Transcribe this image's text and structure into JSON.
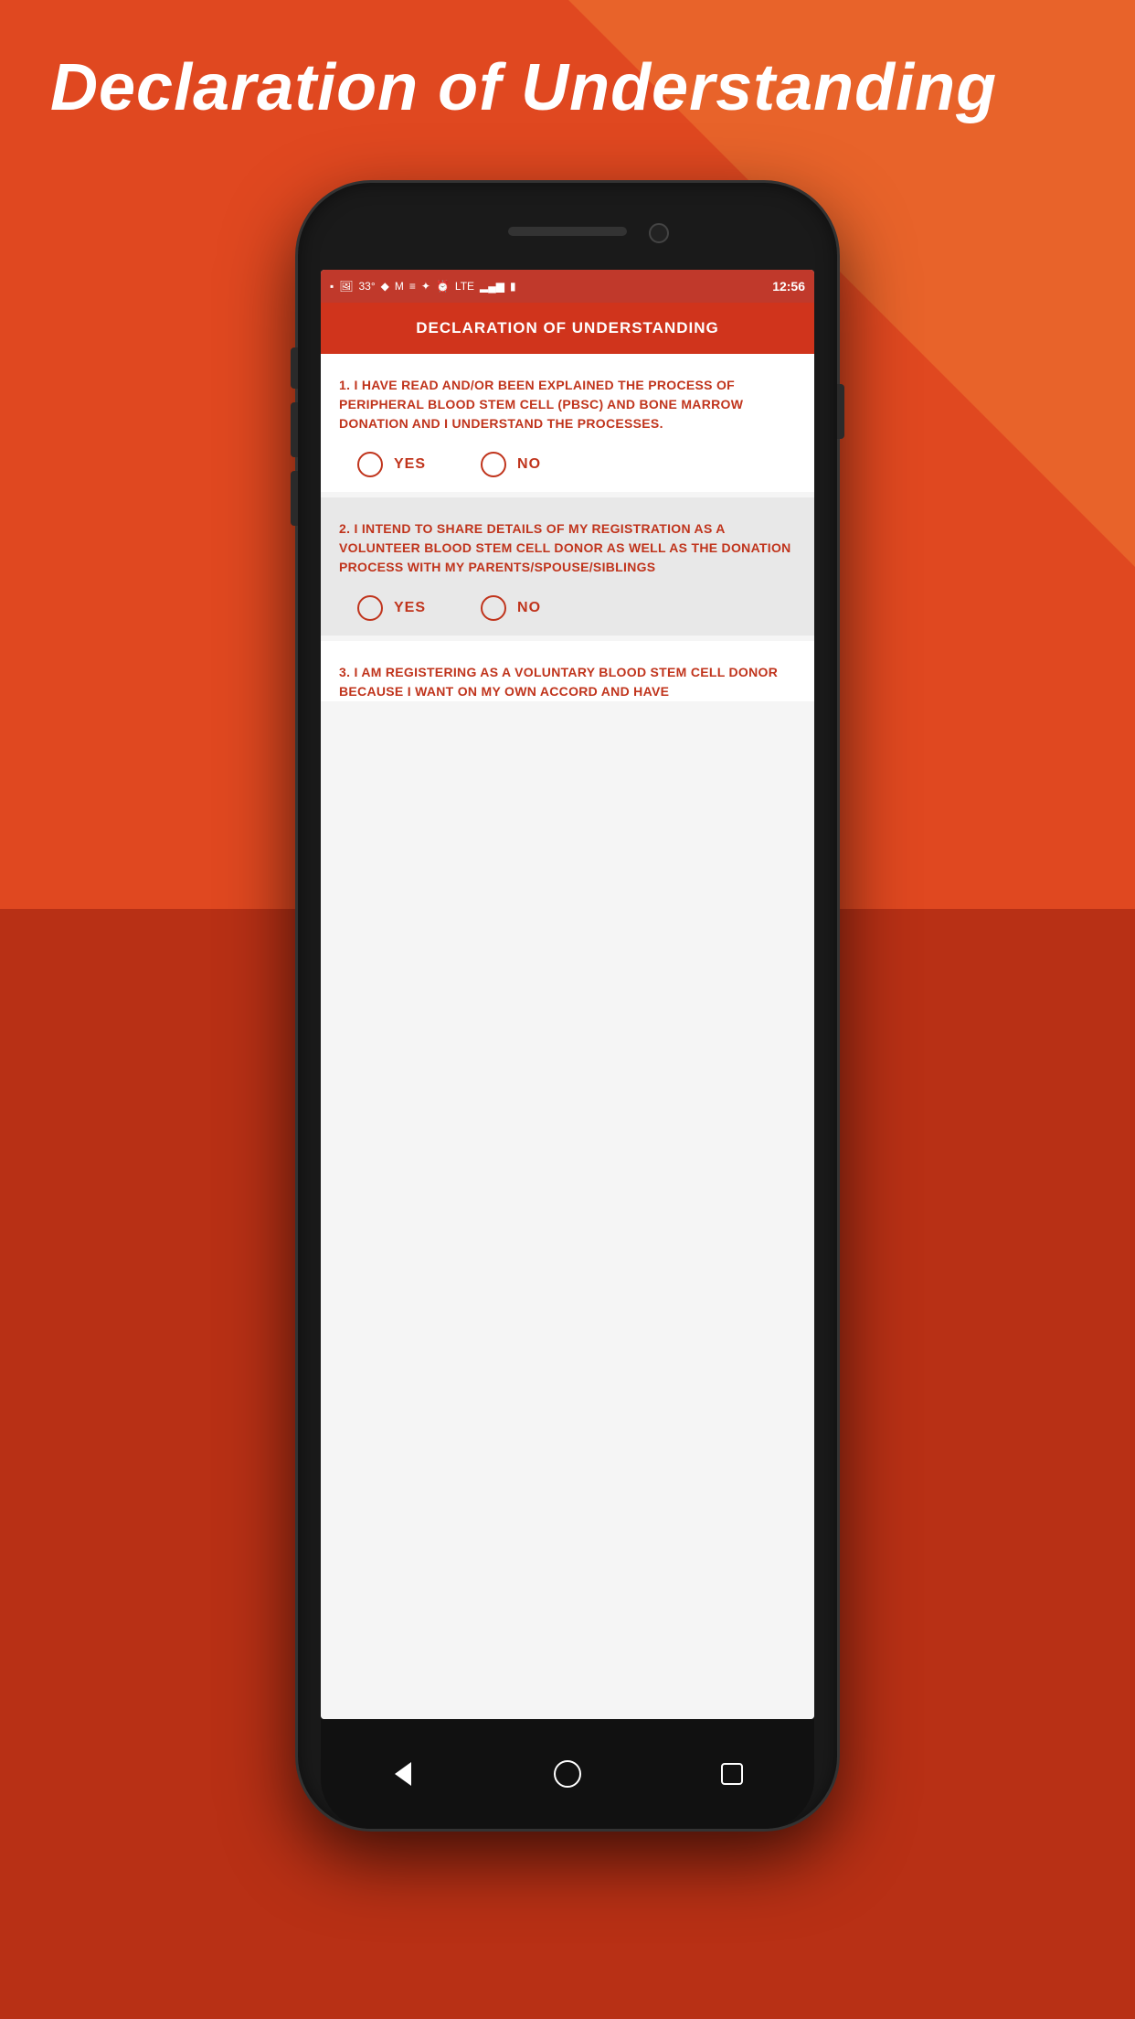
{
  "page": {
    "title": "Declaration of Understanding",
    "background_top_color": "#E04820",
    "background_bottom_color": "#B83015"
  },
  "status_bar": {
    "time": "12:56",
    "signal": "LTE",
    "battery": "100",
    "temperature": "33°"
  },
  "app_bar": {
    "title": "DECLARATION OF UNDERSTANDING"
  },
  "questions": [
    {
      "id": 1,
      "text": "1. I HAVE READ AND/OR BEEN EXPLAINED THE PROCESS OF PERIPHERAL BLOOD STEM CELL (PBSC) AND BONE MARROW DONATION AND I UNDERSTAND THE PROCESSES.",
      "options": [
        "YES",
        "NO"
      ],
      "shaded": false
    },
    {
      "id": 2,
      "text": "2. I INTEND TO SHARE DETAILS OF MY REGISTRATION AS A VOLUNTEER BLOOD STEM CELL DONOR AS WELL AS THE DONATION PROCESS WITH MY PARENTS/SPOUSE/SIBLINGS",
      "options": [
        "YES",
        "NO"
      ],
      "shaded": true
    },
    {
      "id": 3,
      "text": "3. I AM REGISTERING AS A VOLUNTARY BLOOD STEM CELL DONOR BECAUSE I WANT ON MY OWN ACCORD AND HAVE",
      "options": [],
      "shaded": false,
      "partial": true
    }
  ],
  "nav": {
    "back_label": "back",
    "home_label": "home",
    "recents_label": "recents"
  }
}
